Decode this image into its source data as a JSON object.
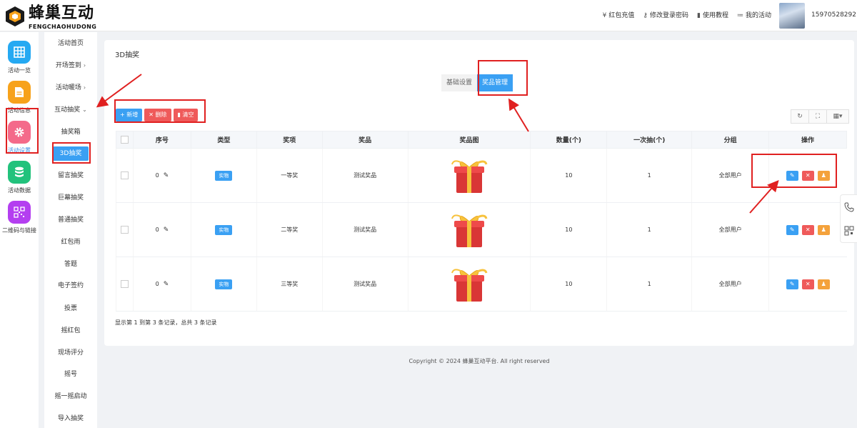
{
  "brand": {
    "name_cn": "蜂巢互动",
    "name_en": "FENGCHAOHUDONG",
    "accent": "#3aa0f3"
  },
  "topnav": {
    "items": [
      {
        "icon": "yen-icon",
        "glyph": "¥",
        "label": "红包充值"
      },
      {
        "icon": "key-icon",
        "glyph": "⚷",
        "label": "修改登录密码"
      },
      {
        "icon": "doc-icon",
        "glyph": "▮",
        "label": "使用教程"
      },
      {
        "icon": "list-icon",
        "glyph": "≔",
        "label": "我的活动"
      }
    ],
    "user_phone": "15970528292"
  },
  "iconnav": {
    "items": [
      {
        "label": "活动一览",
        "icon": "grid-icon",
        "color": "#25a9f2"
      },
      {
        "label": "活动信息",
        "icon": "document-icon",
        "color": "#f7a21b"
      },
      {
        "label": "活动设置",
        "icon": "gear-icon",
        "color": "#f46a8a"
      },
      {
        "label": "活动数据",
        "icon": "database-icon",
        "color": "#22c27c"
      },
      {
        "label": "二维码与链接",
        "icon": "qrcode-icon",
        "color": "#b43ff0"
      }
    ]
  },
  "subnav": {
    "items": [
      {
        "label": "活动首页",
        "arrow": ""
      },
      {
        "label": "开场签到",
        "arrow": "›"
      },
      {
        "label": "活动暖场",
        "arrow": "›"
      },
      {
        "label": "互动抽奖",
        "arrow": "⌄"
      },
      {
        "label": "抽奖箱",
        "arrow": ""
      },
      {
        "label": "3D抽奖",
        "arrow": ""
      },
      {
        "label": "留言抽奖",
        "arrow": ""
      },
      {
        "label": "巨幕抽奖",
        "arrow": ""
      },
      {
        "label": "普通抽奖",
        "arrow": ""
      },
      {
        "label": "红包雨",
        "arrow": ""
      },
      {
        "label": "答题",
        "arrow": ""
      },
      {
        "label": "电子签约",
        "arrow": ""
      },
      {
        "label": "投票",
        "arrow": ""
      },
      {
        "label": "摇红包",
        "arrow": ""
      },
      {
        "label": "现场评分",
        "arrow": ""
      },
      {
        "label": "摇号",
        "arrow": ""
      },
      {
        "label": "摇一摇启动",
        "arrow": ""
      },
      {
        "label": "导入抽奖",
        "arrow": ""
      }
    ]
  },
  "main": {
    "title": "3D抽奖",
    "tabs": [
      "基础设置",
      "奖品管理"
    ],
    "buttons": {
      "add": "+ 新增",
      "delete": "✕ 删除",
      "clear": "▮ 清空"
    },
    "tools": [
      "↻",
      "⛶",
      "▦▾"
    ],
    "table": {
      "headers": [
        "序号",
        "类型",
        "奖项",
        "奖品",
        "奖品图",
        "数量(个)",
        "一次抽(个)",
        "分组",
        "操作"
      ],
      "rows": [
        {
          "seq": "0",
          "type": "实物",
          "award": "一等奖",
          "prize": "测试奖品",
          "qty": "10",
          "per_draw": "1",
          "group": "全部用户"
        },
        {
          "seq": "0",
          "type": "实物",
          "award": "二等奖",
          "prize": "测试奖品",
          "qty": "10",
          "per_draw": "1",
          "group": "全部用户"
        },
        {
          "seq": "0",
          "type": "实物",
          "award": "三等奖",
          "prize": "测试奖品",
          "qty": "10",
          "per_draw": "1",
          "group": "全部用户"
        }
      ]
    },
    "pagination_info": "显示第 1 到第 3 条记录，总共 3 条记录"
  },
  "footer": {
    "copyright": "Copyright © 2024 蜂巢互动平台. All right reserved"
  }
}
